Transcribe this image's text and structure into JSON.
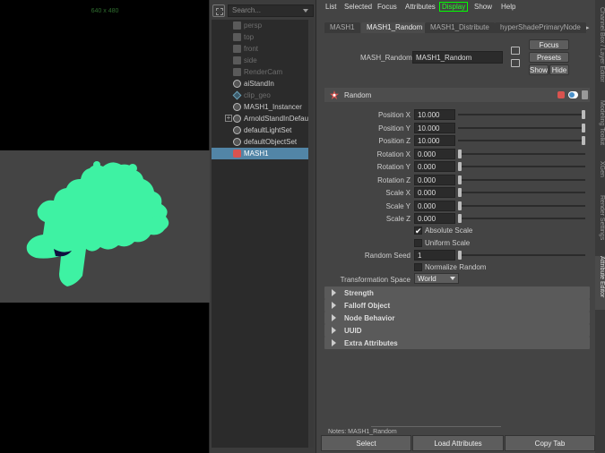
{
  "viewport": {
    "resolution_label": "640 x 480",
    "mesh_color": "#3ef2a3"
  },
  "outliner": {
    "search_placeholder": "Search...",
    "items": [
      {
        "label": "persp",
        "icon": "camera-icon",
        "dim": true
      },
      {
        "label": "top",
        "icon": "camera-icon",
        "dim": true
      },
      {
        "label": "front",
        "icon": "camera-icon",
        "dim": true
      },
      {
        "label": "side",
        "icon": "camera-icon",
        "dim": true
      },
      {
        "label": "RenderCam",
        "icon": "camera-icon",
        "dim": true
      },
      {
        "label": "aiStandIn",
        "icon": "standin-icon",
        "dim": false
      },
      {
        "label": "clip_geo",
        "icon": "geometry-icon",
        "dim": true
      },
      {
        "label": "MASH1_Instancer",
        "icon": "instancer-icon",
        "dim": false
      },
      {
        "label": "ArnoldStandInDefaul",
        "icon": "standin-icon",
        "dim": false,
        "expandable": true
      },
      {
        "label": "defaultLightSet",
        "icon": "set-icon",
        "dim": false
      },
      {
        "label": "defaultObjectSet",
        "icon": "set-icon",
        "dim": false
      },
      {
        "label": "MASH1",
        "icon": "mash-icon",
        "dim": false,
        "selected": true
      }
    ]
  },
  "menubar": {
    "list": "List",
    "selected": "Selected",
    "focus": "Focus",
    "attributes": "Attributes",
    "display": "Display",
    "show": "Show",
    "help": "Help"
  },
  "tabs": [
    "MASH1",
    "MASH1_Random",
    "MASH1_Distribute",
    "hyperShadePrimaryNode"
  ],
  "active_tab": "MASH1_Random",
  "node": {
    "type_label": "MASH_Random:",
    "name": "MASH1_Random"
  },
  "buttons": {
    "focus": "Focus",
    "presets": "Presets",
    "show": "Show",
    "hide": "Hide"
  },
  "random_section": {
    "title": "Random",
    "attributes": [
      {
        "label": "Position X",
        "value": "10.000",
        "slider": 1.0
      },
      {
        "label": "Position Y",
        "value": "10.000",
        "slider": 1.0
      },
      {
        "label": "Position Z",
        "value": "10.000",
        "slider": 1.0
      },
      {
        "label": "Rotation X",
        "value": "0.000",
        "slider": 0.0
      },
      {
        "label": "Rotation Y",
        "value": "0.000",
        "slider": 0.0
      },
      {
        "label": "Rotation Z",
        "value": "0.000",
        "slider": 0.0
      },
      {
        "label": "Scale X",
        "value": "0.000",
        "slider": 0.0
      },
      {
        "label": "Scale Y",
        "value": "0.000",
        "slider": 0.0
      },
      {
        "label": "Scale Z",
        "value": "0.000",
        "slider": 0.0
      }
    ],
    "absolute_scale": {
      "label": "Absolute Scale",
      "checked": true
    },
    "uniform_scale": {
      "label": "Uniform Scale",
      "checked": false
    },
    "random_seed": {
      "label": "Random Seed",
      "value": "1",
      "slider": 0.0
    },
    "normalize_random": {
      "label": "Normalize Random",
      "checked": false
    },
    "transformation_space": {
      "label": "Transformation Space",
      "value": "World"
    }
  },
  "collapsed_sections": [
    "Strength",
    "Falloff Object",
    "Node Behavior",
    "UUID",
    "Extra Attributes"
  ],
  "notes_label": "Notes:  MASH1_Random",
  "bottom_buttons": {
    "select": "Select",
    "load": "Load Attributes",
    "copy": "Copy Tab"
  },
  "side_tabs": [
    {
      "label": "Channel Box / Layer Editor",
      "active": false
    },
    {
      "label": "Modeling Toolkit",
      "active": false
    },
    {
      "label": "XGen",
      "active": false
    },
    {
      "label": "Render Settings",
      "active": false
    },
    {
      "label": "Attribute Editor",
      "active": true
    }
  ]
}
